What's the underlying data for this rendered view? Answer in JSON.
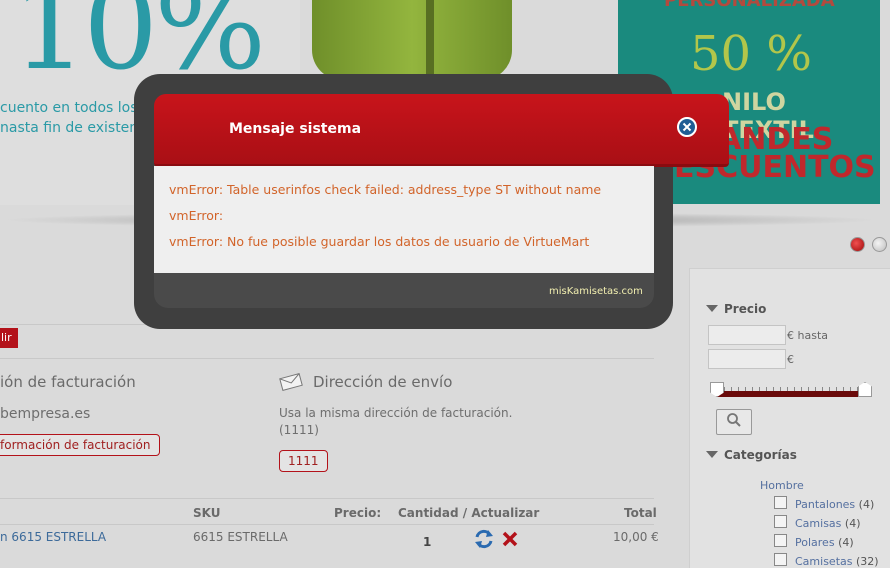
{
  "banner": {
    "left_big": "10%",
    "left_line1": "cuento en todos los",
    "left_line2": "nasta fin de existenc",
    "right_top": "PERSONALIZADA",
    "right_pct": "50 %",
    "right_line": "NILO TEXTIL",
    "right_big1": "ANDES",
    "right_big2": "ESCUENTOS"
  },
  "checkout": {
    "red_tab": "lir",
    "billing_title": "ión de facturación",
    "billing_email": "bempresa.es",
    "billing_button": "formación de facturación",
    "shipping_title": "Dirección de envío",
    "shipping_desc": "Usa la misma dirección de facturación.",
    "shipping_code": "(1111)",
    "shipping_button": "1111",
    "table_headers": {
      "sku": "SKU",
      "price": "Precio:",
      "qty": "Cantidad / Actualizar",
      "total": "Total"
    },
    "row": {
      "name": "n 6615 ESTRELLA",
      "sku": "6615 ESTRELLA",
      "qty": "1",
      "total": "10,00 €"
    }
  },
  "sidebar": {
    "price_heading": "Precio",
    "price_until_label": "€ hasta",
    "price_currency_label": "€",
    "categories_heading": "Categorías",
    "category_parent": "Hombre",
    "categories": [
      {
        "name": "Pantalones",
        "count": "(4)"
      },
      {
        "name": "Camisas",
        "count": "(4)"
      },
      {
        "name": "Polares",
        "count": "(4)"
      },
      {
        "name": "Camisetas",
        "count": "(32)"
      }
    ]
  },
  "modal": {
    "title": "Mensaje sistema",
    "messages": [
      "vmError: Table userinfos check failed: address_type ST without name",
      "vmError:",
      "vmError: No fue posible guardar los datos de usuario de VirtueMart"
    ],
    "footer": "misKamisetas.com"
  },
  "colors": {
    "modal_header": "#c8141b",
    "error_text": "#d2642a",
    "accent_teal": "#2a9aa6"
  }
}
